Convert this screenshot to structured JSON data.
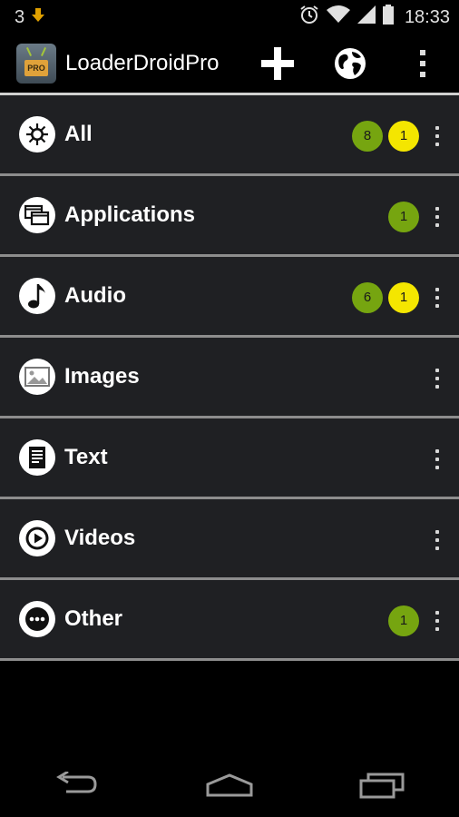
{
  "status_bar": {
    "notification_count": "3",
    "time": "18:33"
  },
  "action_bar": {
    "title": "LoaderDroidPro",
    "app_icon_badge": "PRO"
  },
  "colors": {
    "badge_green": "#76a510",
    "badge_yellow": "#f4e600",
    "row_background": "#1f2023"
  },
  "categories": [
    {
      "label": "All",
      "icon": "all-icon",
      "green_count": "8",
      "yellow_count": "1"
    },
    {
      "label": "Applications",
      "icon": "applications-icon",
      "green_count": "1"
    },
    {
      "label": "Audio",
      "icon": "music-note-icon",
      "green_count": "6",
      "yellow_count": "1"
    },
    {
      "label": "Images",
      "icon": "image-icon"
    },
    {
      "label": "Text",
      "icon": "document-icon"
    },
    {
      "label": "Videos",
      "icon": "play-icon"
    },
    {
      "label": "Other",
      "icon": "more-icon",
      "green_count": "1"
    }
  ]
}
